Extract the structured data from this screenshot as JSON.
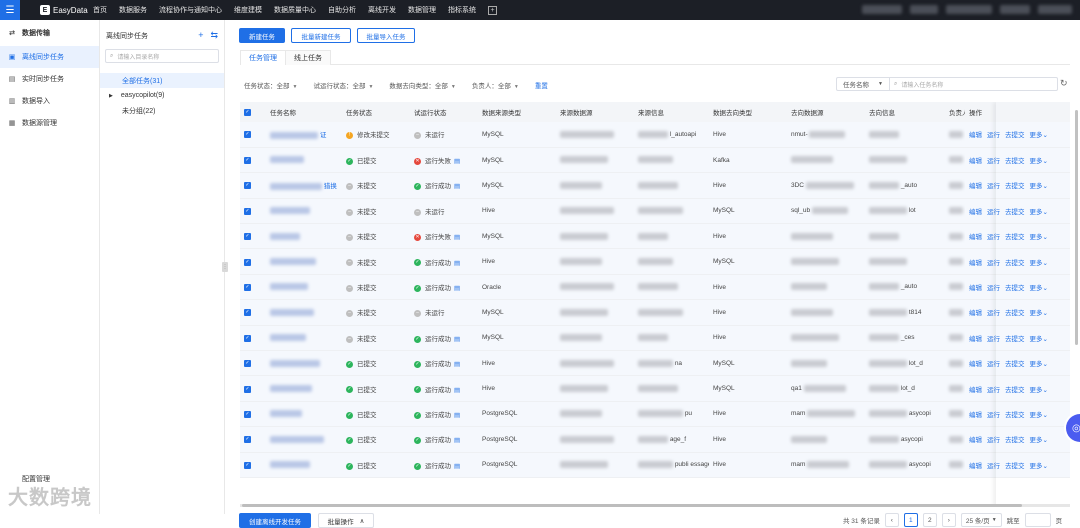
{
  "topbar": {
    "brand": "EasyData",
    "nav": [
      "首页",
      "数据服务",
      "流程协作与通知中心",
      "维度建模",
      "数据质量中心",
      "自助分析",
      "离线开发",
      "数据管理",
      "指标系统"
    ]
  },
  "sidebar": {
    "group_label": "数据传输",
    "items": [
      {
        "label": "离线同步任务",
        "icon": "sync-icon"
      },
      {
        "label": "实时同步任务",
        "icon": "realtime-icon"
      },
      {
        "label": "数据导入",
        "icon": "import-icon"
      },
      {
        "label": "数据源管理",
        "icon": "datasource-icon"
      }
    ],
    "footer_label": "配置管理",
    "watermark_logo": "大数跨境"
  },
  "tree": {
    "title": "离线同步任务",
    "search_placeholder": "请输入目录名称",
    "nodes": [
      {
        "label": "全部任务(31)",
        "active": true
      },
      {
        "label": "easycopilot(9)",
        "active": false
      },
      {
        "label": "未分组(22)",
        "active": false
      }
    ]
  },
  "toolbar": {
    "new_task": "新建任务",
    "batch_new": "批量新建任务",
    "batch_import": "批量导入任务"
  },
  "tabs": [
    "任务管理",
    "线上任务"
  ],
  "filters": {
    "task_status": "任务状态：全部",
    "trial_status": "试运行状态：全部",
    "target_type": "数据去向类型：全部",
    "owner": "负责人：全部",
    "reset": "重置",
    "search_field": "任务名称",
    "search_placeholder": "请输入任务名称"
  },
  "table": {
    "headers": [
      "任务名称",
      "任务状态",
      "试运行状态",
      "数据来源类型",
      "来源数据源",
      "来源信息",
      "数据去向类型",
      "去向数据源",
      "去向信息",
      "负责人",
      "操作"
    ],
    "rows": [
      {
        "name": "证",
        "status": "修改未提交",
        "status_color": "orange",
        "trial": "未运行",
        "trial_color": "gray",
        "trial_doc": false,
        "source_type": "MySQL",
        "source_info": "l_autoapi",
        "target_type": "Hive",
        "target_ds": "nmut-",
        "target_info": "",
        "more": "更多"
      },
      {
        "name": "",
        "status": "已提交",
        "status_color": "green",
        "trial": "运行失败",
        "trial_color": "red",
        "trial_doc": true,
        "source_type": "MySQL",
        "source_info": "",
        "target_type": "Kafka",
        "target_ds": "",
        "target_info": "",
        "more": "更多"
      },
      {
        "name": "猎换",
        "status": "未提交",
        "status_color": "gray",
        "trial": "运行成功",
        "trial_color": "green",
        "trial_doc": true,
        "source_type": "MySQL",
        "source_info": "",
        "target_type": "Hive",
        "target_ds": "3DC",
        "target_info": "_auto",
        "more": "更多"
      },
      {
        "name": "",
        "status": "未提交",
        "status_color": "gray",
        "trial": "未运行",
        "trial_color": "gray",
        "trial_doc": false,
        "source_type": "Hive",
        "source_info": "",
        "target_type": "MySQL",
        "target_ds": "sql_ub",
        "target_info": "lot",
        "more": "更多"
      },
      {
        "name": "",
        "status": "未提交",
        "status_color": "gray",
        "trial": "运行失败",
        "trial_color": "red",
        "trial_doc": true,
        "source_type": "MySQL",
        "source_info": "",
        "target_type": "Hive",
        "target_ds": "",
        "target_info": "",
        "more": "更多"
      },
      {
        "name": "",
        "status": "未提交",
        "status_color": "gray",
        "trial": "运行成功",
        "trial_color": "green",
        "trial_doc": true,
        "source_type": "Hive",
        "source_info": "",
        "target_type": "MySQL",
        "target_ds": "",
        "target_info": "",
        "more": "更多"
      },
      {
        "name": "",
        "status": "未提交",
        "status_color": "gray",
        "trial": "运行成功",
        "trial_color": "green",
        "trial_doc": true,
        "source_type": "Oracle",
        "source_info": "",
        "target_type": "Hive",
        "target_ds": "",
        "target_info": "_auto",
        "more": "更多"
      },
      {
        "name": "",
        "status": "未提交",
        "status_color": "gray",
        "trial": "未运行",
        "trial_color": "gray",
        "trial_doc": false,
        "source_type": "MySQL",
        "source_info": "",
        "target_type": "Hive",
        "target_ds": "",
        "target_info": "t814",
        "more": "更多"
      },
      {
        "name": "",
        "status": "未提交",
        "status_color": "gray",
        "trial": "运行成功",
        "trial_color": "green",
        "trial_doc": true,
        "source_type": "MySQL",
        "source_info": "",
        "target_type": "Hive",
        "target_ds": "",
        "target_info": "_ces",
        "more": "更多"
      },
      {
        "name": "",
        "status": "已提交",
        "status_color": "green",
        "trial": "运行成功",
        "trial_color": "green",
        "trial_doc": true,
        "source_type": "Hive",
        "source_info": "na",
        "target_type": "MySQL",
        "target_ds": "",
        "target_info": "lot_d",
        "more": "更多"
      },
      {
        "name": "",
        "status": "已提交",
        "status_color": "green",
        "trial": "运行成功",
        "trial_color": "green",
        "trial_doc": true,
        "source_type": "Hive",
        "source_info": "",
        "target_type": "MySQL",
        "target_ds": "qa1",
        "target_info": "lot_d",
        "more": "更多"
      },
      {
        "name": "",
        "status": "已提交",
        "status_color": "green",
        "trial": "运行成功",
        "trial_color": "green",
        "trial_doc": true,
        "source_type": "PostgreSQL",
        "source_info": "pu",
        "target_type": "Hive",
        "target_ds": "mam",
        "target_info": "asycopi",
        "more": "更多"
      },
      {
        "name": "",
        "status": "已提交",
        "status_color": "green",
        "trial": "运行成功",
        "trial_color": "green",
        "trial_doc": true,
        "source_type": "PostgreSQL",
        "source_info": "age_f",
        "target_type": "Hive",
        "target_ds": "",
        "target_info": "asycopi",
        "more": "更多"
      },
      {
        "name": "",
        "status": "已提交",
        "status_color": "green",
        "trial": "运行成功",
        "trial_color": "green",
        "trial_doc": true,
        "source_type": "PostgreSQL",
        "source_info": "publi essages",
        "target_type": "Hive",
        "target_ds": "mam",
        "target_info": "asycopi",
        "more": "更多"
      }
    ],
    "actions": [
      "编辑",
      "运行",
      "去提交"
    ]
  },
  "footer": {
    "create_dev": "创建离线开发任务",
    "batch_ops": "批量操作",
    "total": "共 31 条记录",
    "pages": [
      "1",
      "2"
    ],
    "page_size": "25 条/页",
    "jump": "跳至",
    "page_unit": "页"
  }
}
